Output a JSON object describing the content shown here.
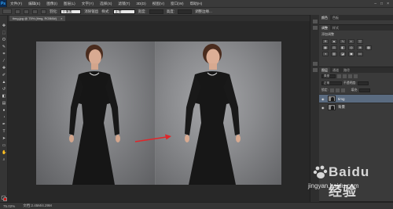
{
  "app": {
    "logo": "Ps"
  },
  "menu": {
    "items": [
      "文件(F)",
      "编辑(E)",
      "图像(I)",
      "图层(L)",
      "文字(Y)",
      "选择(S)",
      "滤镜(T)",
      "3D(D)",
      "视图(V)",
      "窗口(W)",
      "帮助(H)"
    ],
    "window_controls": [
      "–",
      "□",
      "×"
    ]
  },
  "options_bar": {
    "feather_label": "羽化:",
    "feather_value": "0 像素",
    "antialias_label": "消除锯齿",
    "style_label": "样式:",
    "style_value": "正常",
    "width_label": "宽度:",
    "height_label": "高度:",
    "refine_label": "调整边缘..."
  },
  "document": {
    "tab_title": "timg.jpg @ 75% (timg, RGB/8#)",
    "zoom": "75.02%",
    "doc_info": "文档:2.45M/4.29M"
  },
  "panels": {
    "top_tabs": [
      "颜色",
      "色板"
    ],
    "adjust_tabs": [
      "调整",
      "样式"
    ],
    "adjust_title": "添加调整",
    "layers_tabs": [
      "图层",
      "通道",
      "路径"
    ],
    "kind_label": "类型",
    "blend_mode": "正常",
    "opacity_label": "不透明度:",
    "lock_label": "锁定:",
    "fill_label": "填充:",
    "layers": [
      {
        "name": "timg",
        "visible": true,
        "selected": true
      },
      {
        "name": "背景",
        "visible": true,
        "selected": false
      }
    ]
  },
  "canvas": {
    "arrow_color": "#e0262a"
  },
  "watermark": {
    "brand": "Baidu 经验",
    "url": "jingyan.baidu.com"
  },
  "colors": {
    "foreground": "#111111",
    "background": "#c81818"
  }
}
